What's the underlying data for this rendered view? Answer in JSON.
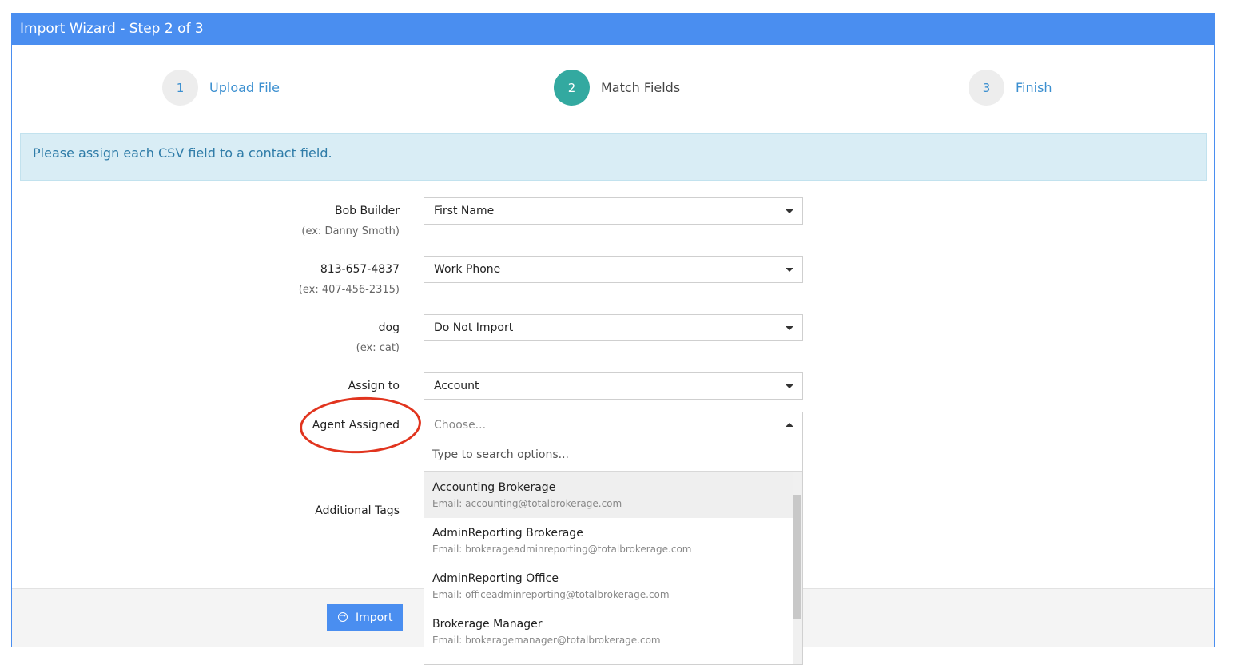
{
  "window": {
    "title": "Import Wizard - Step 2 of 3"
  },
  "steps": [
    {
      "number": "1",
      "label": "Upload File"
    },
    {
      "number": "2",
      "label": "Match Fields"
    },
    {
      "number": "3",
      "label": "Finish"
    }
  ],
  "alert": {
    "text": "Please assign each CSV field to a contact field."
  },
  "fields": [
    {
      "label": "Bob Builder",
      "hint": "(ex: Danny Smoth)",
      "value": "First Name"
    },
    {
      "label": "813-657-4837",
      "hint": "(ex: 407-456-2315)",
      "value": "Work Phone"
    },
    {
      "label": "dog",
      "hint": "(ex: cat)",
      "value": "Do Not Import"
    }
  ],
  "assign_to": {
    "label": "Assign to",
    "value": "Account"
  },
  "agent_assigned": {
    "label": "Agent Assigned",
    "placeholder": "Choose...",
    "search_placeholder": "Type to search options...",
    "options": [
      {
        "name": "Accounting Brokerage",
        "email": "Email: accounting@totalbrokerage.com"
      },
      {
        "name": "AdminReporting Brokerage",
        "email": "Email: brokerageadminreporting@totalbrokerage.com"
      },
      {
        "name": "AdminReporting Office",
        "email": "Email: officeadminreporting@totalbrokerage.com"
      },
      {
        "name": "Brokerage Manager",
        "email": "Email: brokeragemanager@totalbrokerage.com"
      }
    ]
  },
  "additional_tags": {
    "label": "Additional Tags"
  },
  "footer": {
    "import_label": "Import"
  },
  "colors": {
    "primary": "#4a8ef0",
    "active_step": "#33a9a0",
    "alert_bg": "#d9edf5",
    "annotation": "#e1341e"
  }
}
